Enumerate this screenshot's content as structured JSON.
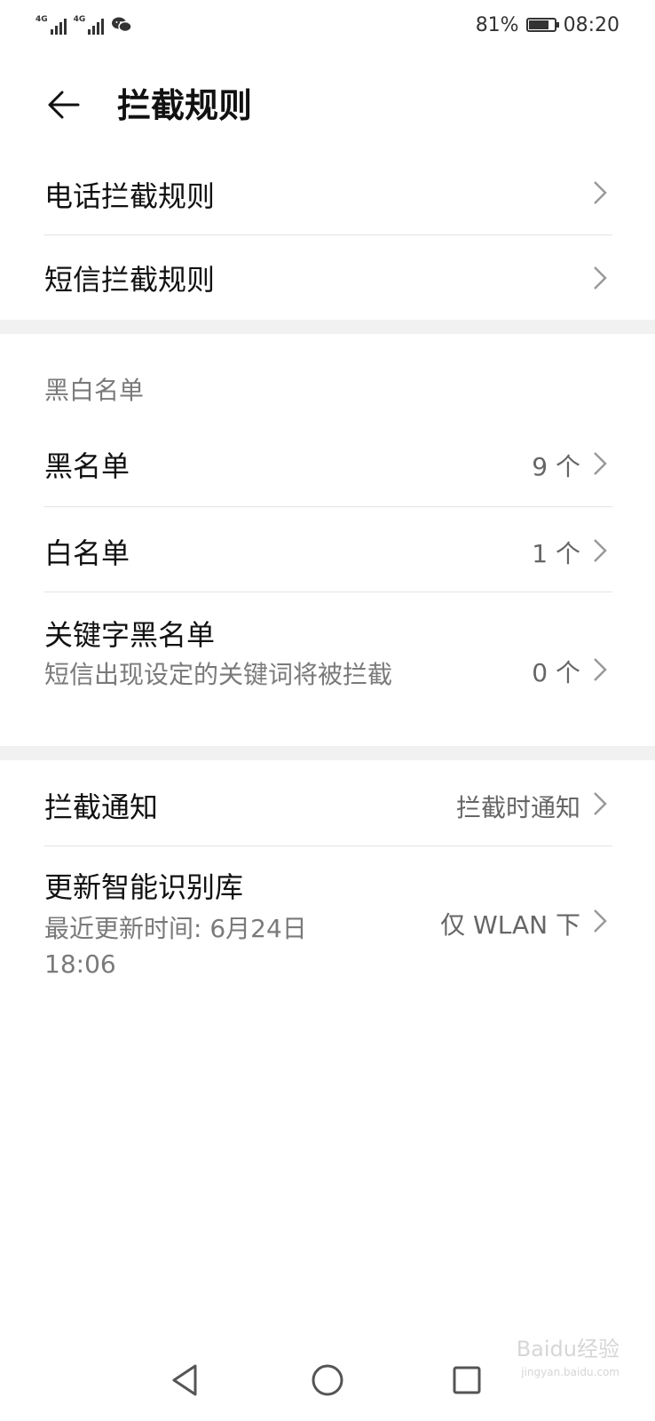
{
  "status_bar": {
    "sim1_label": "4G",
    "sim2_label": "4G",
    "app_icon": "wechat-icon",
    "battery_percent": "81%",
    "battery_level": 0.81,
    "time": "08:20"
  },
  "header": {
    "back_icon": "arrow-left-icon",
    "title": "拦截规则"
  },
  "rules": {
    "call_rules": "电话拦截规则",
    "sms_rules": "短信拦截规则"
  },
  "lists": {
    "section_label": "黑白名单",
    "blacklist": {
      "title": "黑名单",
      "value": "9 个"
    },
    "whitelist": {
      "title": "白名单",
      "value": "1 个"
    },
    "keyword_blacklist": {
      "title": "关键字黑名单",
      "subtitle": "短信出现设定的关键词将被拦截",
      "value": "0 个"
    }
  },
  "other": {
    "notification": {
      "title": "拦截通知",
      "value": "拦截时通知"
    },
    "update_library": {
      "title": "更新智能识别库",
      "subtitle": "最近更新时间: 6月24日 18:06",
      "value": "仅 WLAN 下"
    }
  },
  "nav": {
    "back_icon": "triangle-back-icon",
    "home_icon": "circle-home-icon",
    "recents_icon": "square-recents-icon"
  },
  "watermark": {
    "brand": "Baidu经验",
    "url": "jingyan.baidu.com"
  },
  "colors": {
    "text_primary": "#111111",
    "text_secondary": "#7a7a7a",
    "divider": "#e3e3e3",
    "section_band": "#f1f1f1"
  }
}
